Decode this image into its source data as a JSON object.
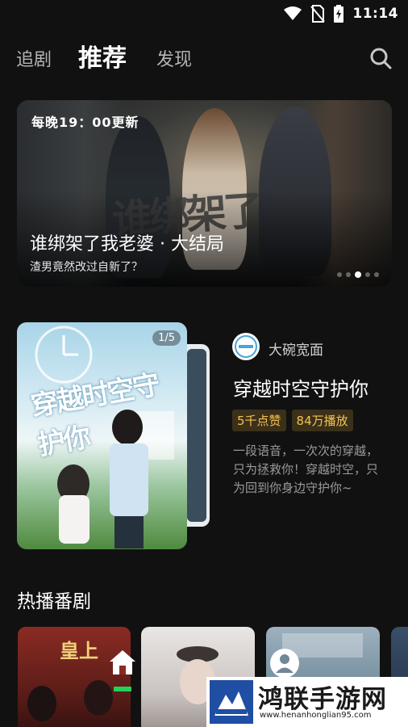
{
  "status_bar": {
    "time": "11:14",
    "icons": [
      "wifi-icon",
      "no-sim-icon",
      "battery-charging-icon"
    ]
  },
  "top_nav": {
    "tabs": [
      {
        "label": "追剧",
        "active": false
      },
      {
        "label": "推荐",
        "active": true
      },
      {
        "label": "发现",
        "active": false
      }
    ],
    "search_icon": "search-icon"
  },
  "banner": {
    "schedule": "每晚19：00更新",
    "overlay_title": "谁绑架了",
    "title": "谁绑架了我老婆 · 大结局",
    "subtitle": "渣男竟然改过自新了？",
    "dots_count": 5,
    "active_dot": 2
  },
  "featured": {
    "counter": "1/5",
    "poster_art_text": "穿越时空守护你",
    "channel_name": "大碗宽面",
    "title": "穿越时空守护你",
    "tags": [
      "5千点赞",
      "84万播放"
    ],
    "description": "一段语音，一次次的穿越，只为拯救你！穿越时空，只为回到你身边守护你~"
  },
  "hot_section": {
    "title": "热播番剧",
    "thumb1_text": "皇上"
  },
  "floating_nav": {
    "home_icon": "home-icon",
    "profile_icon": "profile-icon",
    "indicator_color": "#20d35a"
  },
  "watermark": {
    "text": "鸿联手游网",
    "url": "www.henanhonglian95.com"
  },
  "colors": {
    "background": "#111111",
    "tag_text": "#f3c354",
    "tag_bg": "#3b3019"
  }
}
